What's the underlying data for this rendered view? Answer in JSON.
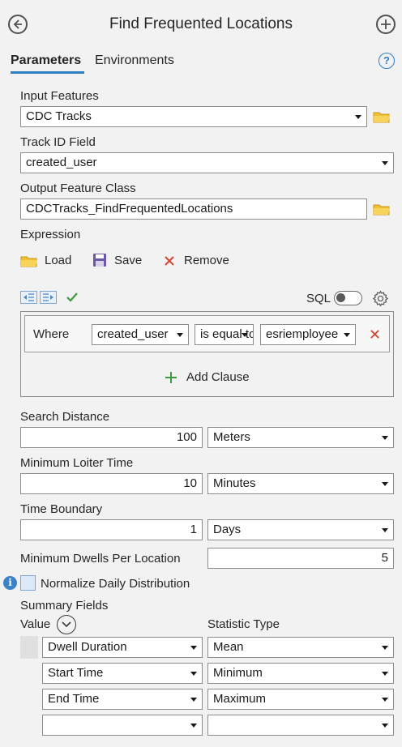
{
  "header": {
    "title": "Find Frequented Locations"
  },
  "tabs": [
    {
      "label": "Parameters",
      "active": true
    },
    {
      "label": "Environments",
      "active": false
    }
  ],
  "help_icon": "question-circle-icon",
  "input_features": {
    "label": "Input Features",
    "value": "CDC Tracks"
  },
  "track_id": {
    "label": "Track ID Field",
    "value": "created_user"
  },
  "output": {
    "label": "Output Feature Class",
    "value": "CDCTracks_FindFrequentedLocations"
  },
  "expression": {
    "label": "Expression",
    "load_label": "Load",
    "save_label": "Save",
    "remove_label": "Remove",
    "sql_label": "SQL",
    "sql_on": false,
    "clause": {
      "where": "Where",
      "field": "created_user",
      "operator": "is equal to",
      "value": "esriemployee"
    },
    "add_clause_label": "Add Clause"
  },
  "search_distance": {
    "label": "Search Distance",
    "value": "100",
    "unit": "Meters"
  },
  "min_loiter": {
    "label": "Minimum Loiter Time",
    "value": "10",
    "unit": "Minutes"
  },
  "time_boundary": {
    "label": "Time Boundary",
    "value": "1",
    "unit": "Days"
  },
  "min_dwells": {
    "label": "Minimum Dwells Per Location",
    "value": "5"
  },
  "normalize": {
    "label": "Normalize Daily Distribution",
    "checked": false
  },
  "summary": {
    "label": "Summary Fields",
    "value_header": "Value",
    "stat_header": "Statistic Type",
    "rows": [
      {
        "value": "Dwell Duration",
        "stat": "Mean"
      },
      {
        "value": "Start Time",
        "stat": "Minimum"
      },
      {
        "value": "End Time",
        "stat": "Maximum"
      },
      {
        "value": "",
        "stat": ""
      }
    ]
  },
  "colors": {
    "accent": "#2f7ec4",
    "folder": "#f2c12e",
    "add": "#3d9a3d",
    "remove": "#d9432f"
  }
}
